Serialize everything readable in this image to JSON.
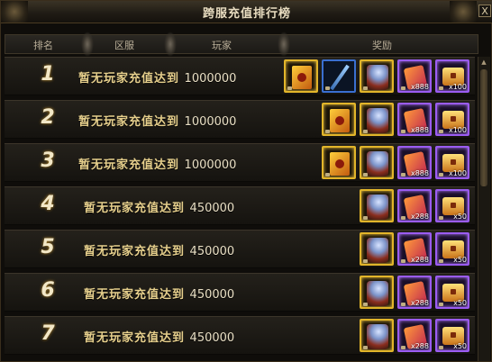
{
  "window": {
    "title": "跨服充值排行榜",
    "close_glyph": "X"
  },
  "header": {
    "rank": "排名",
    "server": "区服",
    "player": "玩家",
    "reward": "奖励"
  },
  "rows": [
    {
      "rank": "1",
      "desc": "暂无玩家充值达到",
      "amount": "1000000",
      "rewards": [
        {
          "type": "book",
          "style": "gold",
          "qty": ""
        },
        {
          "type": "weapon",
          "style": "blue",
          "qty": ""
        },
        {
          "type": "warrior",
          "style": "gold",
          "qty": ""
        },
        {
          "type": "scroll",
          "style": "purple",
          "qty": "x888"
        },
        {
          "type": "chest",
          "style": "purple",
          "qty": "x100"
        }
      ]
    },
    {
      "rank": "2",
      "desc": "暂无玩家充值达到",
      "amount": "1000000",
      "rewards": [
        {
          "type": "book",
          "style": "gold",
          "qty": ""
        },
        {
          "type": "warrior",
          "style": "gold",
          "qty": ""
        },
        {
          "type": "scroll",
          "style": "purple",
          "qty": "x888"
        },
        {
          "type": "chest",
          "style": "purple",
          "qty": "x100"
        }
      ]
    },
    {
      "rank": "3",
      "desc": "暂无玩家充值达到",
      "amount": "1000000",
      "rewards": [
        {
          "type": "book",
          "style": "gold",
          "qty": ""
        },
        {
          "type": "warrior",
          "style": "gold",
          "qty": ""
        },
        {
          "type": "scroll",
          "style": "purple",
          "qty": "x888"
        },
        {
          "type": "chest",
          "style": "purple",
          "qty": "x100"
        }
      ]
    },
    {
      "rank": "4",
      "desc": "暂无玩家充值达到",
      "amount": "450000",
      "rewards": [
        {
          "type": "warrior",
          "style": "gold",
          "qty": ""
        },
        {
          "type": "scroll",
          "style": "purple",
          "qty": "x288"
        },
        {
          "type": "chest",
          "style": "purple",
          "qty": "x50"
        }
      ]
    },
    {
      "rank": "5",
      "desc": "暂无玩家充值达到",
      "amount": "450000",
      "rewards": [
        {
          "type": "warrior",
          "style": "gold",
          "qty": ""
        },
        {
          "type": "scroll",
          "style": "purple",
          "qty": "x288"
        },
        {
          "type": "chest",
          "style": "purple",
          "qty": "x50"
        }
      ]
    },
    {
      "rank": "6",
      "desc": "暂无玩家充值达到",
      "amount": "450000",
      "rewards": [
        {
          "type": "warrior",
          "style": "gold",
          "qty": ""
        },
        {
          "type": "scroll",
          "style": "purple",
          "qty": "x288"
        },
        {
          "type": "chest",
          "style": "purple",
          "qty": "x50"
        }
      ]
    },
    {
      "rank": "7",
      "desc": "暂无玩家充值达到",
      "amount": "450000",
      "rewards": [
        {
          "type": "warrior",
          "style": "gold",
          "qty": ""
        },
        {
          "type": "scroll",
          "style": "purple",
          "qty": "x288"
        },
        {
          "type": "chest",
          "style": "purple",
          "qty": "x50"
        }
      ]
    }
  ]
}
